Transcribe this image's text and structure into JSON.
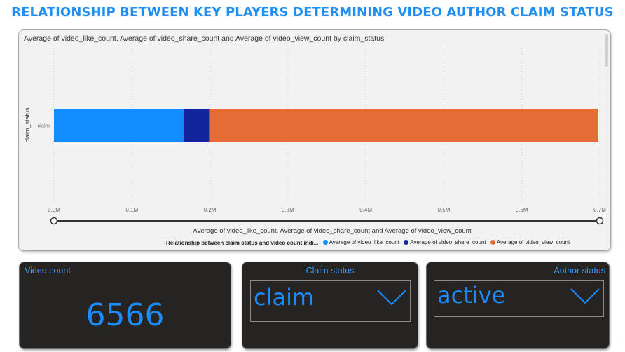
{
  "page_title": "RELATIONSHIP BETWEEN KEY PLAYERS DETERMINING VIDEO AUTHOR CLAIM STATUS",
  "chart": {
    "subtitle": "Average of video_like_count, Average of video_share_count and Average of video_view_count by claim_status",
    "x_axis_title": "Average of video_like_count, Average of video_share_count and Average of video_view_count",
    "y_axis_title": "claim_status",
    "legend_title": "Relationship between claim status and video count indi...",
    "legend": [
      {
        "label": "Average of video_like_count",
        "color": "#118dff"
      },
      {
        "label": "Average of video_share_count",
        "color": "#12239e"
      },
      {
        "label": "Average of video_view_count",
        "color": "#e66c37"
      }
    ]
  },
  "chart_data": {
    "type": "bar",
    "orientation": "horizontal",
    "stacked": true,
    "categories": [
      "claim"
    ],
    "series": [
      {
        "name": "Average of video_like_count",
        "values": [
          166000
        ],
        "color": "#118dff"
      },
      {
        "name": "Average of video_share_count",
        "values": [
          33000
        ],
        "color": "#12239e"
      },
      {
        "name": "Average of video_view_count",
        "values": [
          499000
        ],
        "color": "#e66c37"
      }
    ],
    "xlim": [
      0,
      700000
    ],
    "x_ticks": [
      {
        "value": 0,
        "label": "0.0M"
      },
      {
        "value": 100000,
        "label": "0.1M"
      },
      {
        "value": 200000,
        "label": "0.2M"
      },
      {
        "value": 300000,
        "label": "0.3M"
      },
      {
        "value": 400000,
        "label": "0.4M"
      },
      {
        "value": 500000,
        "label": "0.5M"
      },
      {
        "value": 600000,
        "label": "0.6M"
      },
      {
        "value": 700000,
        "label": "0.7M"
      }
    ],
    "grid": true,
    "legend_position": "bottom"
  },
  "cards": {
    "video_count": {
      "label": "Video count",
      "value": "6566"
    },
    "claim_status": {
      "label": "Claim status",
      "selected": "claim"
    },
    "author_status": {
      "label": "Author status",
      "selected": "active"
    }
  }
}
